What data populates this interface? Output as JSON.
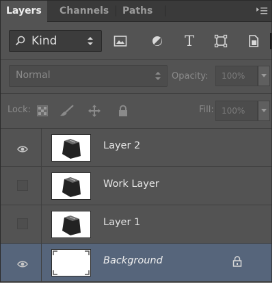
{
  "tabs": [
    {
      "label": "Layers",
      "active": true
    },
    {
      "label": "Channels",
      "active": false
    },
    {
      "label": "Paths",
      "active": false
    }
  ],
  "filter": {
    "kind_label": "Kind",
    "type_icon_glyph": "T",
    "icons": [
      "search-icon",
      "updown-icon",
      "image-filter-icon",
      "adjustment-filter-icon",
      "type-filter-icon",
      "shape-filter-icon",
      "smart-object-filter-icon"
    ]
  },
  "blend": {
    "mode": "Normal",
    "opacity_label": "Opacity:",
    "opacity_value": "100%"
  },
  "lock": {
    "label": "Lock:",
    "fill_label": "Fill:",
    "fill_value": "100%"
  },
  "layers": [
    {
      "name": "Layer 2",
      "visible": true,
      "selected": false,
      "locked": false,
      "thumbnail": "briefcase"
    },
    {
      "name": "Work Layer",
      "visible": false,
      "selected": false,
      "locked": false,
      "thumbnail": "briefcase"
    },
    {
      "name": "Layer 1",
      "visible": false,
      "selected": false,
      "locked": false,
      "thumbnail": "briefcase"
    },
    {
      "name": "Background",
      "visible": true,
      "selected": true,
      "locked": true,
      "thumbnail": "white"
    }
  ],
  "colors": {
    "panel": "#535353",
    "tabbar": "#3a3a3a",
    "selected_row": "#56657b",
    "text": "#e6e6e6",
    "muted_text": "#8b8b8b"
  }
}
